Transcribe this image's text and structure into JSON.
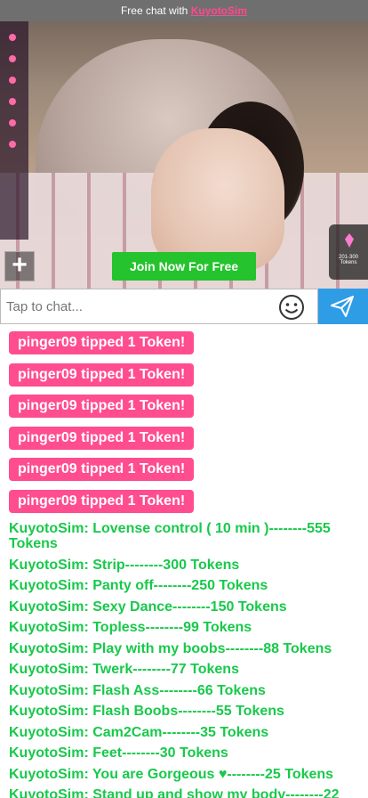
{
  "banner": {
    "prefix": "Free chat with",
    "link": "KuyotoSim"
  },
  "stream": {
    "panel_label_1": "201-300",
    "panel_label_2": "Tokens"
  },
  "actions": {
    "join_label": "Join Now For Free",
    "plus_label": "+"
  },
  "chat_input": {
    "placeholder": "Tap to chat..."
  },
  "tips": [
    "pinger09 tipped 1 Token!",
    "pinger09 tipped 1 Token!",
    "pinger09 tipped 1 Token!",
    "pinger09 tipped 1 Token!",
    "pinger09 tipped 1 Token!",
    "pinger09 tipped 1 Token!"
  ],
  "menu": [
    "KuyotoSim: Lovense control  ( 10 min )--------555 Tokens",
    "KuyotoSim: Strip--------300 Tokens",
    "KuyotoSim: Panty off--------250 Tokens",
    "KuyotoSim: Sexy Dance--------150 Tokens",
    "KuyotoSim: Topless--------99 Tokens",
    "KuyotoSim: Play with my boobs--------88 Tokens",
    "KuyotoSim: Twerk--------77 Tokens",
    "KuyotoSim: Flash Ass--------66 Tokens",
    "KuyotoSim: Flash Boobs--------55 Tokens",
    "KuyotoSim: Cam2Cam--------35 Tokens",
    "KuyotoSim: Feet--------30 Tokens",
    "KuyotoSim: You are Gorgeous  ♥--------25 Tokens",
    "KuyotoSim: Stand up and show my body--------22"
  ],
  "colors": {
    "tip_bg": "#ff4d8f",
    "menu_text": "#18c94b",
    "join_bg": "#25c32d",
    "send_bg": "#2f9ce6"
  }
}
